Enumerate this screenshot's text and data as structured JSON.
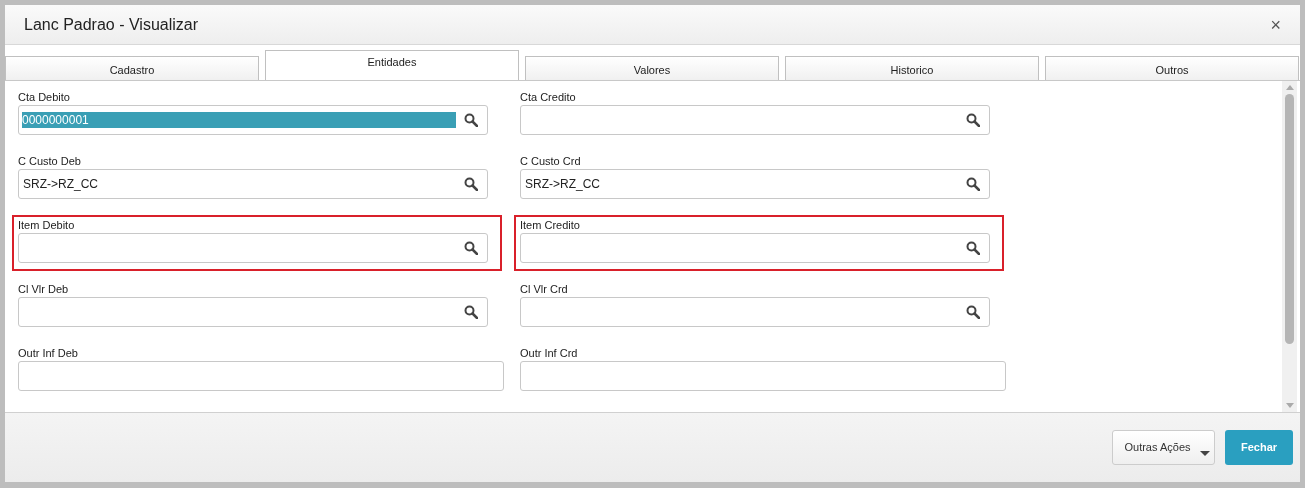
{
  "window": {
    "title": "Lanc Padrao - Visualizar",
    "close": "×"
  },
  "tabs": [
    {
      "label": "Cadastro",
      "selected": false
    },
    {
      "label": "Entidades",
      "selected": true
    },
    {
      "label": "Valores",
      "selected": false
    },
    {
      "label": "Historico",
      "selected": false
    },
    {
      "label": "Outros",
      "selected": false
    }
  ],
  "rows": [
    [
      {
        "label": "Cta Debito",
        "value": "0000000001",
        "kind": "lookup",
        "text_selected": true,
        "highlighted": false
      },
      {
        "label": "Cta Credito",
        "kind": "lookup",
        "highlighted": false
      }
    ],
    [
      {
        "label": "C Custo Deb",
        "value": "SRZ->RZ_CC",
        "kind": "lookup",
        "text_selected": false,
        "highlighted": false
      },
      {
        "label": "C Custo Crd",
        "value": "SRZ->RZ_CC",
        "kind": "lookup",
        "text_selected": false,
        "highlighted": false
      }
    ],
    [
      {
        "label": "Item Debito",
        "kind": "lookup",
        "highlighted": true
      },
      {
        "label": "Item Credito",
        "kind": "lookup",
        "highlighted": true
      }
    ],
    [
      {
        "label": "Cl Vlr Deb",
        "kind": "lookup",
        "highlighted": false
      },
      {
        "label": "Cl Vlr Crd",
        "kind": "lookup",
        "highlighted": false
      }
    ],
    [
      {
        "label": "Outr Inf Deb",
        "kind": "text",
        "highlighted": false
      },
      {
        "label": "Outr Inf Crd",
        "kind": "text",
        "highlighted": false
      }
    ]
  ],
  "footer": {
    "buttons": [
      {
        "label": "Outras Ações",
        "kind": "dropdown"
      },
      {
        "label": "Fechar",
        "kind": "primary"
      }
    ]
  }
}
